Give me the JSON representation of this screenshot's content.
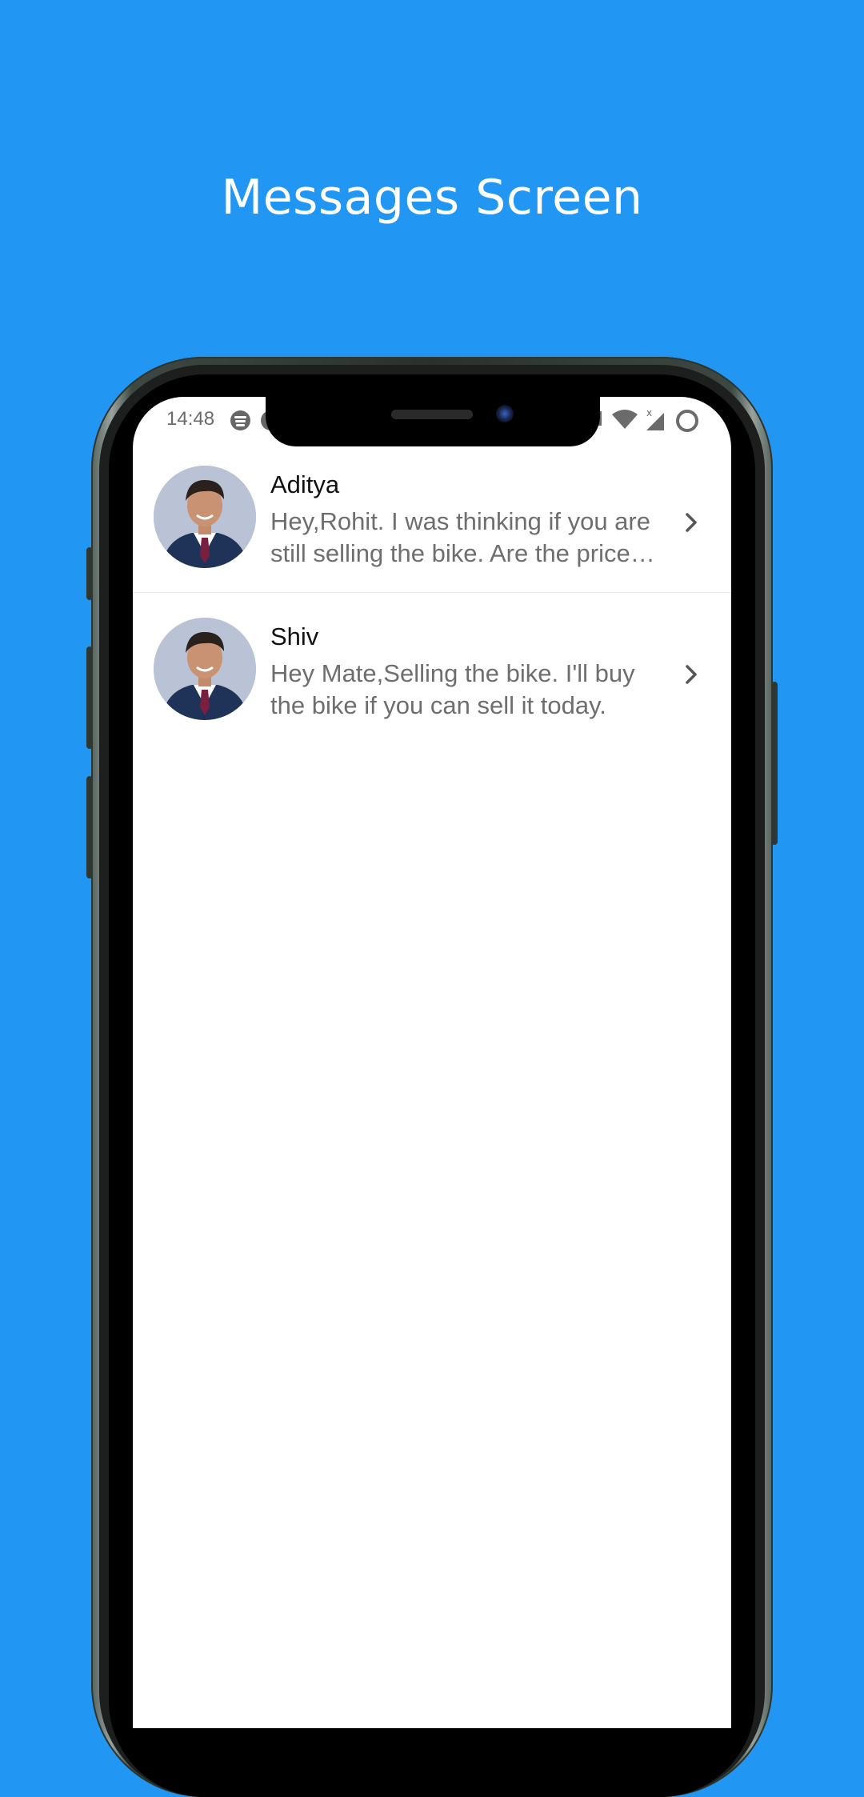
{
  "screen_title": "Messages Screen",
  "status_bar": {
    "time": "14:48",
    "icons": [
      "spotify-icon",
      "notification-icon",
      "wifi-icon",
      "signal-icon",
      "battery-loading-icon"
    ]
  },
  "messages": [
    {
      "name": "Aditya",
      "preview": "Hey,Rohit. I was thinking if you are still selling the bike. Are the price…",
      "avatar": "profile-photo"
    },
    {
      "name": "Shiv",
      "preview": "Hey Mate,Selling the bike. I'll buy the bike if you can sell it today.",
      "avatar": "profile-photo"
    }
  ],
  "colors": {
    "background": "#2196F3",
    "screen": "#FFFFFF",
    "name_text": "#111111",
    "preview_text": "#6E6E6E"
  }
}
